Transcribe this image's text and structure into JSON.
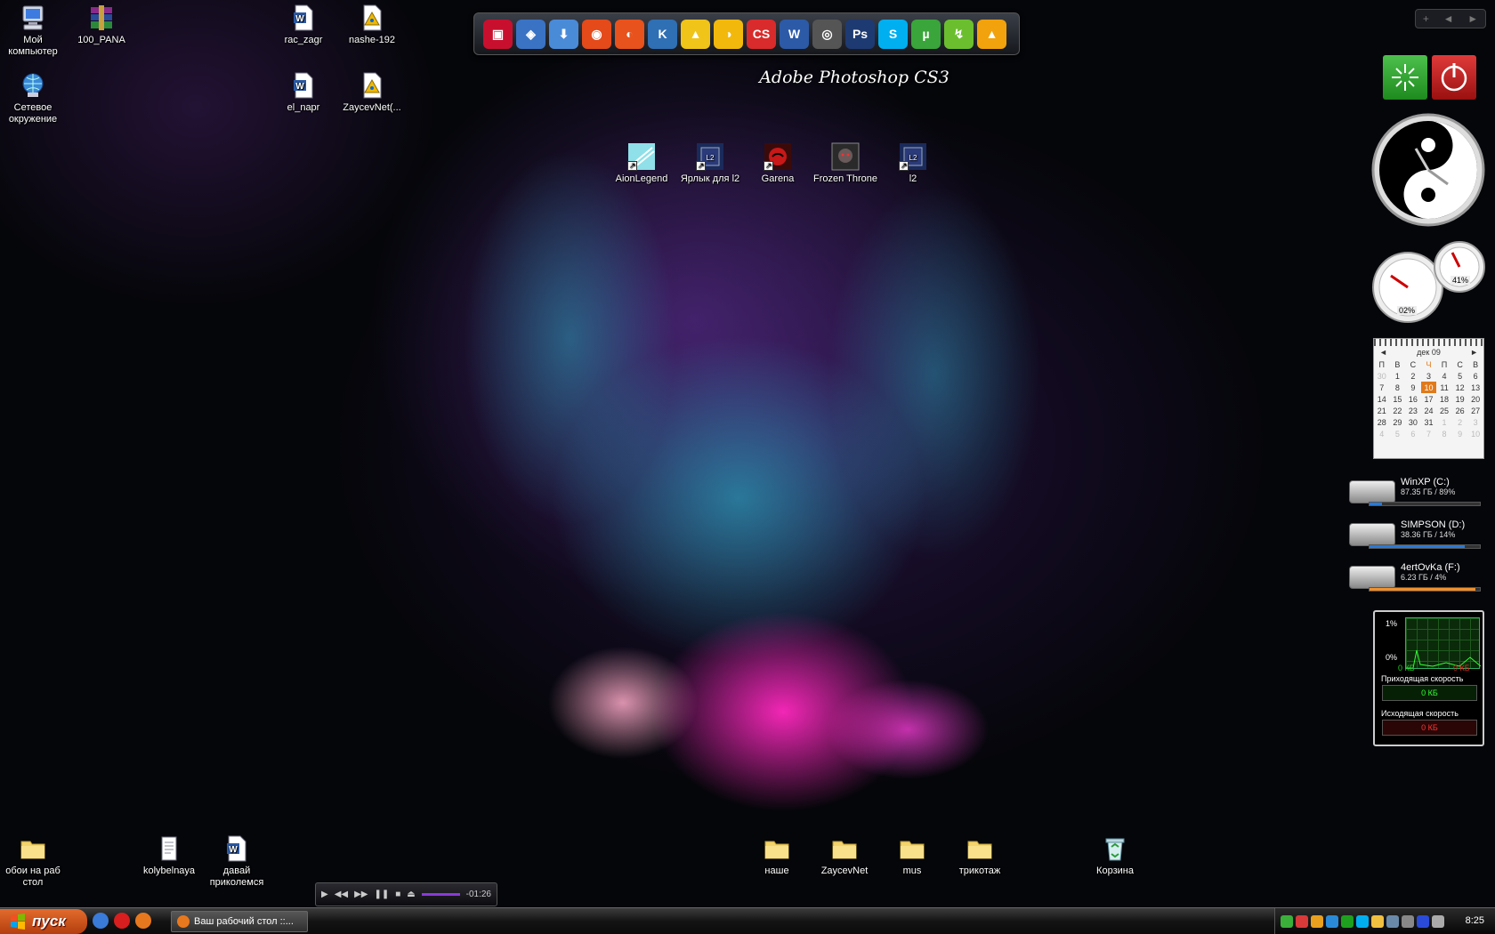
{
  "desktop_icons_left": [
    {
      "label": "Мой компьютер",
      "icon": "my-computer-icon"
    },
    {
      "label": "100_PANA",
      "icon": "winrar-archive-icon"
    },
    {
      "label": "Сетевое окружение",
      "icon": "network-icon"
    }
  ],
  "desktop_icons_top": [
    {
      "label": "rac_zagr",
      "icon": "word-doc-icon"
    },
    {
      "label": "nashe-192",
      "icon": "playlist-icon"
    },
    {
      "label": "el_napr",
      "icon": "word-doc-icon"
    },
    {
      "label": "ZaycevNet(...",
      "icon": "playlist-icon"
    }
  ],
  "game_shortcuts": [
    {
      "label": "AionLegend",
      "icon": "aion-icon"
    },
    {
      "label": "Ярлык для l2",
      "icon": "lineage2-icon"
    },
    {
      "label": "Garena",
      "icon": "garena-icon"
    },
    {
      "label": "Frozen Throne",
      "icon": "warcraft-icon"
    },
    {
      "label": "l2",
      "icon": "lineage2-icon"
    }
  ],
  "bottom_icons": [
    {
      "label": "обои на раб стол",
      "icon": "folder-icon"
    },
    {
      "label": "kolybelnaya",
      "icon": "text-file-icon"
    },
    {
      "label": "давай приколемся",
      "icon": "word-doc-icon"
    },
    {
      "label": "наше",
      "icon": "folder-icon"
    },
    {
      "label": "ZaycevNet",
      "icon": "folder-icon"
    },
    {
      "label": "mus",
      "icon": "folder-icon"
    },
    {
      "label": "трикотаж",
      "icon": "folder-icon"
    },
    {
      "label": "Корзина",
      "icon": "recycle-bin-icon"
    }
  ],
  "quick_launch": {
    "caption": "Adobe Photoshop CS3",
    "items": [
      {
        "icon": "floppy-icon",
        "color": "#c8102e",
        "glyph": "▣"
      },
      {
        "icon": "scanner-icon",
        "color": "#3a73c4",
        "glyph": "◈"
      },
      {
        "icon": "download-icon",
        "color": "#4a8bd8",
        "glyph": "⬇"
      },
      {
        "icon": "burner-icon",
        "color": "#e44a1a",
        "glyph": "◉"
      },
      {
        "icon": "opera-icon",
        "color": "#e8521c",
        "glyph": "◐"
      },
      {
        "icon": "kmplayer-icon",
        "color": "#2f6fb4",
        "glyph": "K"
      },
      {
        "icon": "daemon-tools-icon",
        "color": "#f0c419",
        "glyph": "▲"
      },
      {
        "icon": "aimp-icon",
        "color": "#f2b90c",
        "glyph": "◑"
      },
      {
        "icon": "counter-strike-icon",
        "color": "#d92b2b",
        "glyph": "CS"
      },
      {
        "icon": "word-icon",
        "color": "#2c5aa7",
        "glyph": "W"
      },
      {
        "icon": "photoscape-icon",
        "color": "#555555",
        "glyph": "◎"
      },
      {
        "icon": "photoshop-icon",
        "color": "#1e3a72",
        "glyph": "Ps"
      },
      {
        "icon": "skype-icon",
        "color": "#00aff0",
        "glyph": "S"
      },
      {
        "icon": "utorrent-icon",
        "color": "#3aa53a",
        "glyph": "µ"
      },
      {
        "icon": "gadget-icon",
        "color": "#6bbf2e",
        "glyph": "↯"
      },
      {
        "icon": "aimp-player-icon",
        "color": "#f2a20c",
        "glyph": "▲"
      }
    ]
  },
  "tray_add": {
    "plus": "+",
    "prev": "◄",
    "next": "►"
  },
  "calendar": {
    "month": "дек 09",
    "weekdays": [
      "П",
      "В",
      "С",
      "Ч",
      "П",
      "С",
      "В"
    ],
    "weeks": [
      [
        "30",
        "1",
        "2",
        "3",
        "4",
        "5",
        "6"
      ],
      [
        "7",
        "8",
        "9",
        "10",
        "11",
        "12",
        "13"
      ],
      [
        "14",
        "15",
        "16",
        "17",
        "18",
        "19",
        "20"
      ],
      [
        "21",
        "22",
        "23",
        "24",
        "25",
        "26",
        "27"
      ],
      [
        "28",
        "29",
        "30",
        "31",
        "1",
        "2",
        "3"
      ],
      [
        "4",
        "5",
        "6",
        "7",
        "8",
        "9",
        "10"
      ]
    ],
    "today": "10"
  },
  "cpu_meter": {
    "cpu": "02%",
    "mem": "41%"
  },
  "drives": [
    {
      "name": "WinXP (C:)",
      "info": "87.35 ГБ / 89%",
      "fill": 0.11,
      "color": "#2a7ad8"
    },
    {
      "name": "SIMPSON (D:)",
      "info": "38.36 ГБ / 14%",
      "fill": 0.86,
      "color": "#2a7ad8"
    },
    {
      "name": "4ertOvKa (F:)",
      "info": "6.23 ГБ / 4%",
      "fill": 0.96,
      "color": "#f0902a"
    }
  ],
  "net_monitor": {
    "top_pct": "1%",
    "bottom_pct": "0%",
    "in_kb": "0 КБ",
    "out_kb": "0 КБ",
    "incoming_label": "Приходящая скорость",
    "incoming_value": "0 КБ",
    "outgoing_label": "Исходящая скорость",
    "outgoing_value": "0 КБ"
  },
  "media_player": {
    "time": "-01:26"
  },
  "taskbar": {
    "start_label": "пуск",
    "task_label": "Ваш рабочий стол ::...",
    "clock": "8:25"
  }
}
